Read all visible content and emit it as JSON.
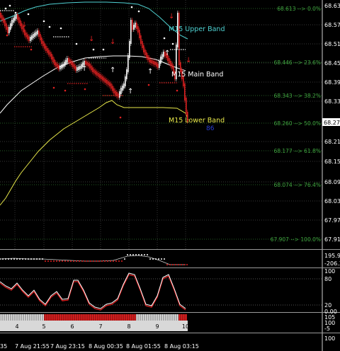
{
  "price_axis": {
    "ticks": [
      "68.635",
      "68.575",
      "68.515",
      "68.455",
      "68.395",
      "68.335",
      "68.215",
      "68.155",
      "68.095",
      "68.035",
      "67.975",
      "67.915"
    ],
    "current_price": "68.276"
  },
  "fib_levels": [
    {
      "label": "68.613 --> 0.0%"
    },
    {
      "label": "68.446 --> 23.6%"
    },
    {
      "label": "68.343 --> 38.2%"
    },
    {
      "label": "68.260 --> 50.0%"
    },
    {
      "label": "68.177 --> 61.8%"
    },
    {
      "label": "68.074 --> 76.4%"
    },
    {
      "label": "67.907 --> 100.0%"
    }
  ],
  "bands": {
    "upper": {
      "label": "M15 Upper Band",
      "color": "#4fd2d2"
    },
    "main": {
      "label": "M15 Main Band",
      "color": "#ffffff"
    },
    "lower": {
      "label": "M15 Lower Band",
      "color": "#e8e84a"
    }
  },
  "marker_text": "86",
  "osc1_axis": {
    "ticks": [
      "195.94",
      "-206.3"
    ]
  },
  "osc2_axis": {
    "ticks": [
      "100",
      "80",
      "20",
      "0.00"
    ]
  },
  "counter_axis": {
    "ticks": [
      "105",
      "100",
      "-5",
      "100"
    ]
  },
  "counter_labels": [
    "4",
    "5",
    "6",
    "7",
    "8",
    "9",
    "10"
  ],
  "time_axis": {
    "labels": [
      "35",
      "7 Aug 21:55",
      "7 Aug 23:15",
      "8 Aug 00:35",
      "8 Aug 01:55",
      "8 Aug 03:15"
    ]
  },
  "colors": {
    "bull": "#ffffff",
    "bear": "#e02020",
    "grid": "#4a4a4a"
  }
}
